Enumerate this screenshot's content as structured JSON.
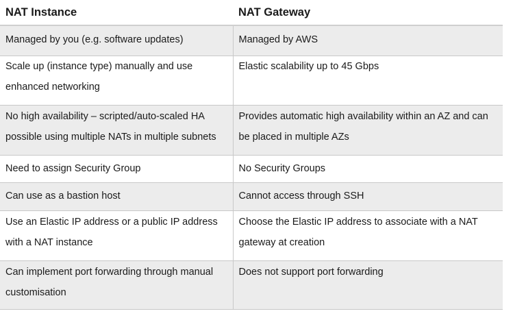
{
  "table": {
    "headers": [
      "NAT Instance",
      "NAT Gateway"
    ],
    "rows": [
      [
        "Managed by you (e.g. software updates)",
        "Managed by AWS"
      ],
      [
        "Scale up (instance type) manually and use enhanced networking",
        "Elastic scalability up to 45 Gbps"
      ],
      [
        "No high availability – scripted/auto-scaled HA possible using multiple NATs in multiple subnets",
        "Provides automatic high availability within an AZ and can be placed in multiple AZs"
      ],
      [
        "Need to assign Security Group",
        "No Security Groups"
      ],
      [
        "Can use as a bastion host",
        "Cannot access through SSH"
      ],
      [
        "Use an Elastic IP address or a public IP address with a NAT instance",
        "Choose the Elastic IP address to associate with a NAT gateway at creation"
      ],
      [
        "Can implement port forwarding through manual customisation",
        "Does not support port forwarding"
      ]
    ]
  }
}
